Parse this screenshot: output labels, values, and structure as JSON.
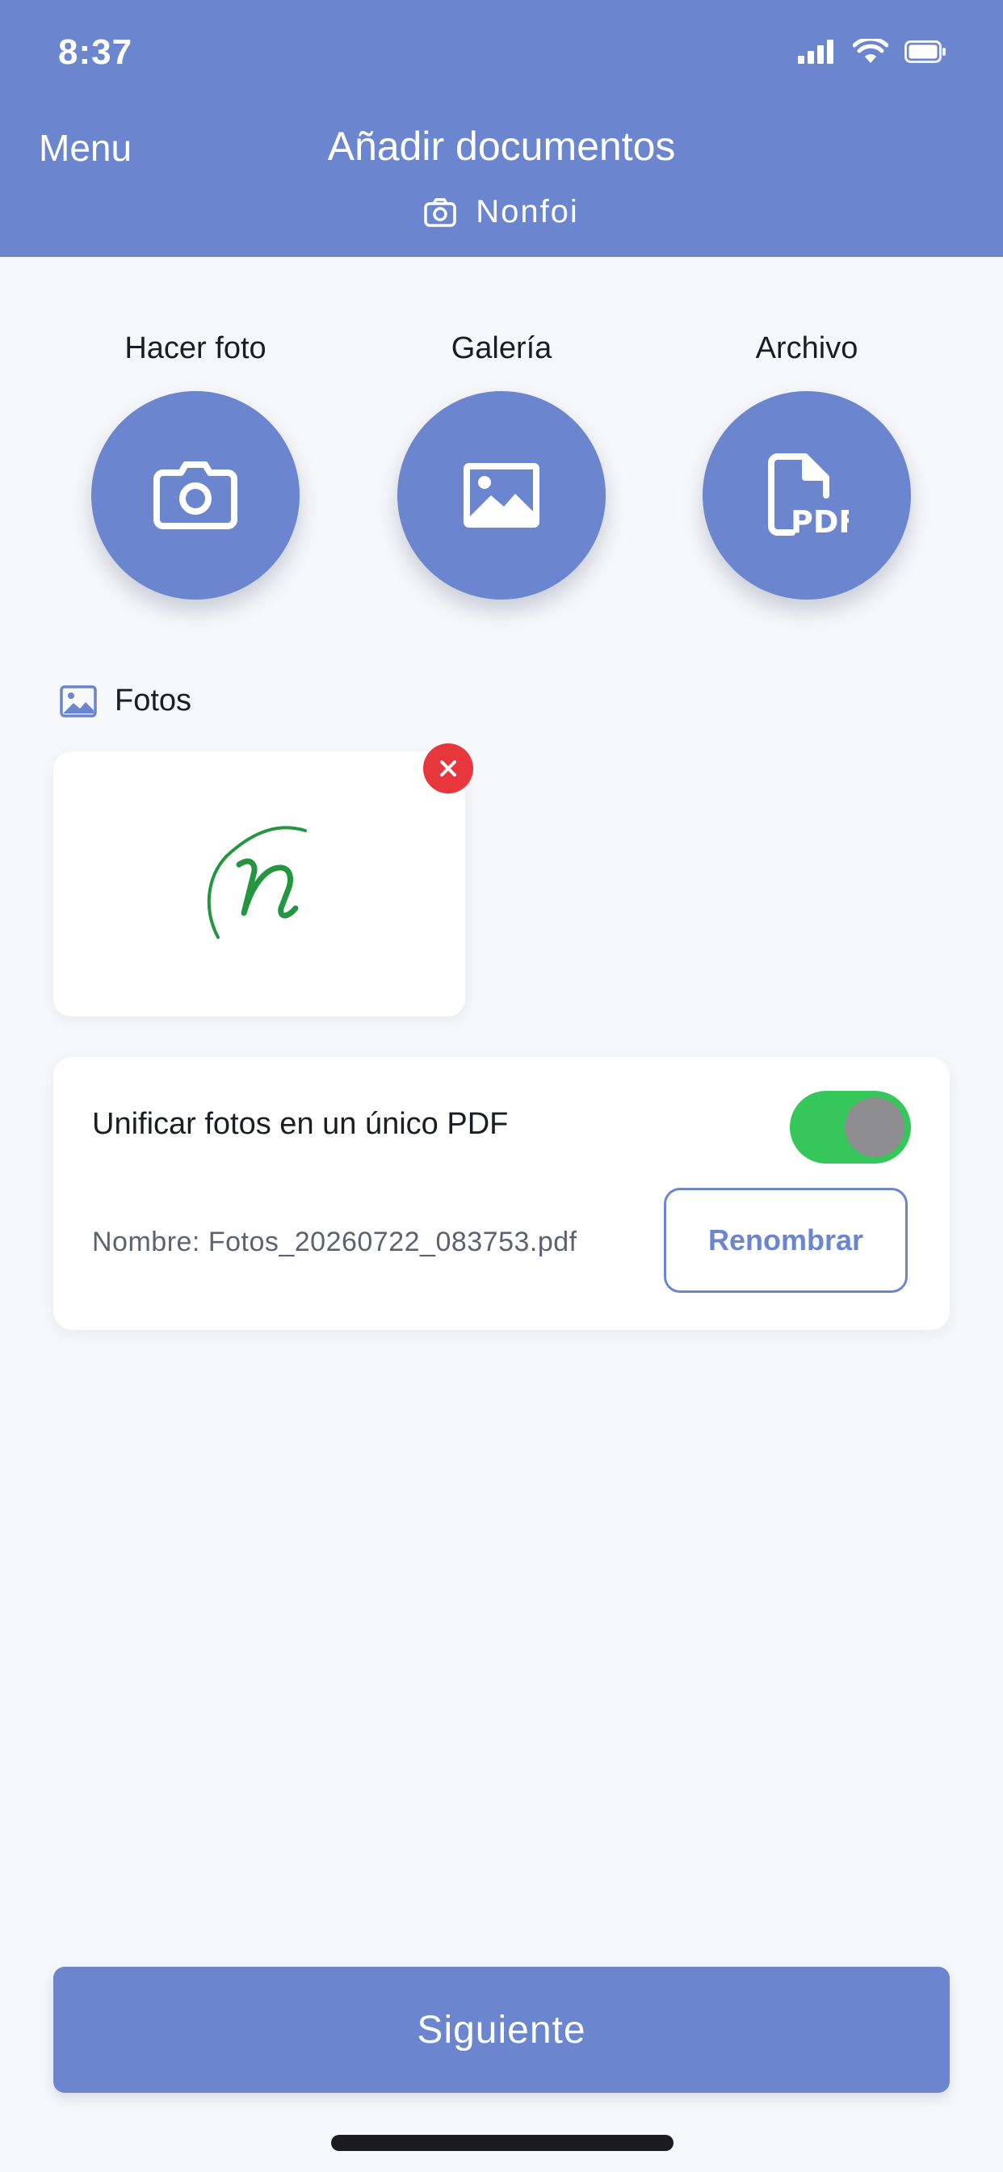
{
  "status_bar": {
    "time": "8:37"
  },
  "header": {
    "menu_label": "Menu",
    "title": "Añadir documentos",
    "subtitle": "Nonfoi",
    "background_color": "#6b86cf"
  },
  "actions": [
    {
      "label": "Hacer foto",
      "icon": "camera-icon"
    },
    {
      "label": "Galería",
      "icon": "image-icon"
    },
    {
      "label": "Archivo",
      "icon": "pdf-file-icon"
    }
  ],
  "photos_section": {
    "title": "Fotos",
    "icon": "image-icon",
    "remove_icon": "close-icon",
    "remove_color": "#e8373c"
  },
  "merge_options": {
    "label": "Unificar fotos en un único PDF",
    "toggle_on": true,
    "toggle_color": "#36c75b",
    "filename": "Nombre: Fotos_20260722_083753.pdf",
    "rename_label": "Renombrar"
  },
  "footer": {
    "next_label": "Siguiente"
  }
}
